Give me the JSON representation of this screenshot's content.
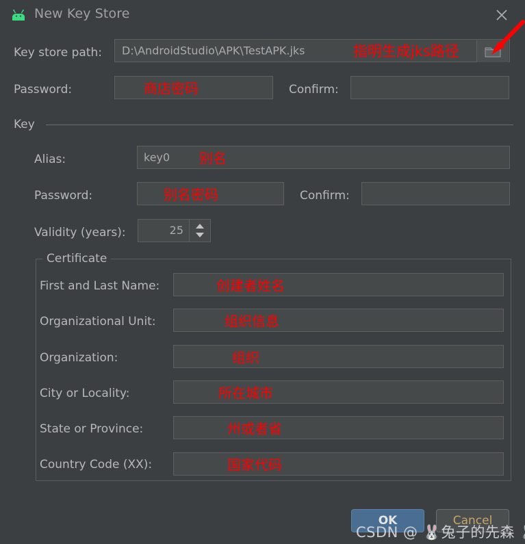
{
  "window": {
    "title": "New Key Store",
    "app_icon": "android-icon",
    "close_icon": "close-icon",
    "accent_blue": "#4a6e92",
    "annotation_color": "#ff0000",
    "background": "#3c3f41"
  },
  "keystore": {
    "path_label": "Key store path:",
    "path_value": "D:\\AndroidStudio\\APK\\TestAPK.jks",
    "path_annotation": "指明生成jks路径",
    "browse_icon": "folder-icon",
    "password_label": "Password:",
    "password_annotation": "商店密码",
    "confirm_label": "Confirm:",
    "confirm_value": ""
  },
  "key_group": {
    "title": "Key",
    "alias_label": "Alias:",
    "alias_value": "key0",
    "alias_annotation": "别名",
    "password_label": "Password:",
    "password_annotation": "别名密码",
    "confirm_label": "Confirm:",
    "confirm_value": "",
    "validity_label": "Validity (years):",
    "validity_value": "25",
    "spinner_icon": "spinner-arrows-icon"
  },
  "certificate": {
    "title": "Certificate",
    "rows": [
      {
        "label": "First and Last Name:",
        "annotation": "创建者姓名"
      },
      {
        "label": "Organizational Unit:",
        "annotation": "组织信息"
      },
      {
        "label": "Organization:",
        "annotation": "组织"
      },
      {
        "label": "City or Locality:",
        "annotation": "所在城市"
      },
      {
        "label": "State or Province:",
        "annotation": "州或者省"
      },
      {
        "label": "Country Code (XX):",
        "annotation": "国家代码"
      }
    ]
  },
  "buttons": {
    "ok": "OK",
    "cancel": "Cancel"
  },
  "watermark": {
    "text": "CSDN @ 🐰兔子的先森 🐰"
  }
}
